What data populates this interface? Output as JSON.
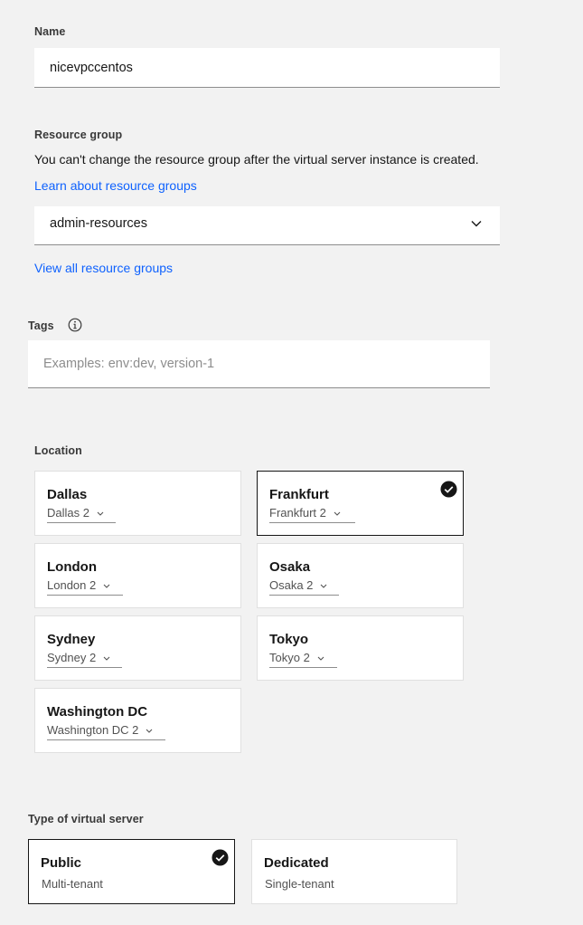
{
  "name_field": {
    "label": "Name",
    "value": "nicevpccentos"
  },
  "resource_group": {
    "label": "Resource group",
    "helper_text": "You can't change the resource group after the virtual server instance is created.",
    "learn_link": "Learn about resource groups",
    "selected": "admin-resources",
    "view_all_link": "View all resource groups"
  },
  "tags": {
    "label": "Tags",
    "info_icon": "information-icon",
    "placeholder": "Examples: env:dev, version-1"
  },
  "location": {
    "label": "Location",
    "tiles": [
      {
        "city": "Dallas",
        "zone": "Dallas 2",
        "selected": false
      },
      {
        "city": "Frankfurt",
        "zone": "Frankfurt 2",
        "selected": true
      },
      {
        "city": "London",
        "zone": "London 2",
        "selected": false
      },
      {
        "city": "Osaka",
        "zone": "Osaka 2",
        "selected": false
      },
      {
        "city": "Sydney",
        "zone": "Sydney 2",
        "selected": false
      },
      {
        "city": "Tokyo",
        "zone": "Tokyo 2",
        "selected": false
      },
      {
        "city": "Washington DC",
        "zone": "Washington DC 2",
        "selected": false
      }
    ]
  },
  "server_type": {
    "label": "Type of virtual server",
    "options": [
      {
        "title": "Public",
        "subtitle": "Multi-tenant",
        "selected": true
      },
      {
        "title": "Dedicated",
        "subtitle": "Single-tenant",
        "selected": false
      }
    ]
  },
  "colors": {
    "background": "#f2f2f2",
    "link": "#0f62fe",
    "text": "#161616",
    "placeholder": "#8d8d8d"
  }
}
